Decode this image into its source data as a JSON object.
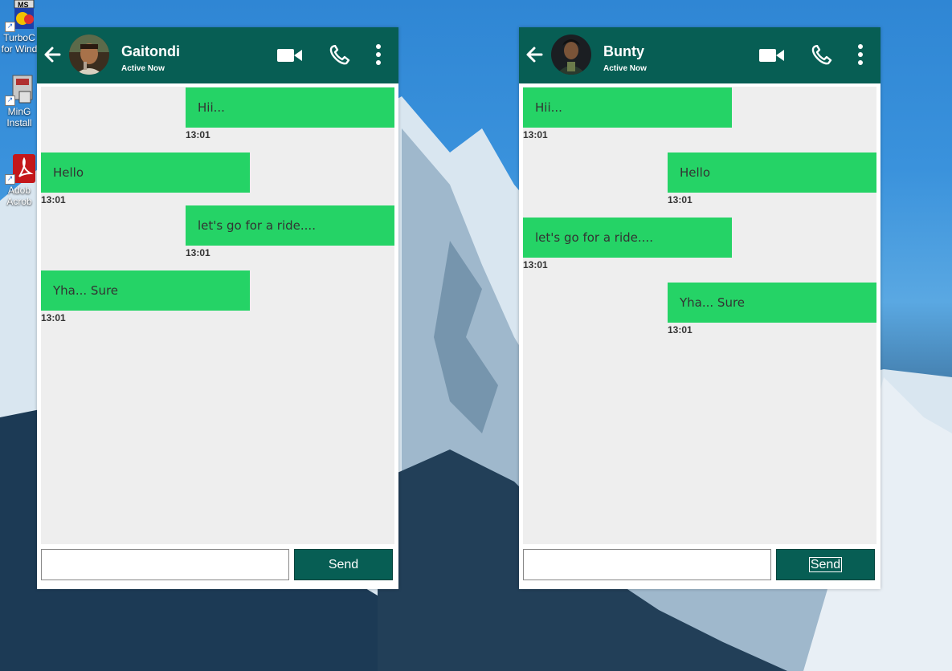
{
  "desktop": {
    "icons": [
      {
        "label_line1": "TurboC",
        "label_line2": "for Wind"
      },
      {
        "label_line1": "MinG",
        "label_line2": "Install"
      },
      {
        "label_line1": "Adob",
        "label_line2": "Acrob"
      }
    ],
    "ms_badge": "MS"
  },
  "windows": [
    {
      "contact_name": "Gaitondi",
      "status": "Active Now",
      "messages": [
        {
          "text": "Hii...",
          "time": "13:01",
          "side": "sent"
        },
        {
          "text": "Hello",
          "time": "13:01",
          "side": "received"
        },
        {
          "text": "let's go for a ride....",
          "time": "13:01",
          "side": "sent"
        },
        {
          "text": "Yha... Sure",
          "time": "13:01",
          "side": "received"
        }
      ],
      "input_value": "",
      "send_label": "Send"
    },
    {
      "contact_name": "Bunty",
      "status": "Active Now",
      "messages": [
        {
          "text": "Hii...",
          "time": "13:01",
          "side": "received"
        },
        {
          "text": "Hello",
          "time": "13:01",
          "side": "sent"
        },
        {
          "text": "let's go for a ride....",
          "time": "13:01",
          "side": "received"
        },
        {
          "text": "Yha... Sure",
          "time": "13:01",
          "side": "sent"
        }
      ],
      "input_value": "",
      "send_label": "Send"
    }
  ],
  "colors": {
    "header": "#075e54",
    "bubble": "#25d366",
    "chat_bg": "#eeeeee"
  },
  "icons": [
    "back-arrow-icon",
    "video-call-icon",
    "phone-icon",
    "more-options-icon"
  ]
}
